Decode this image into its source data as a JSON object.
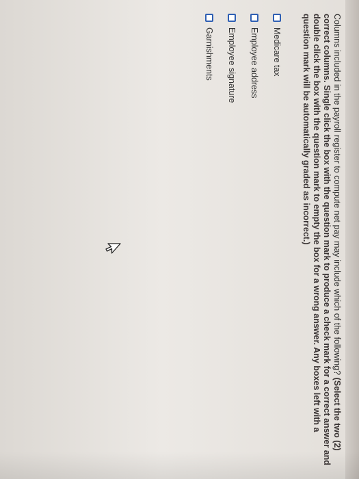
{
  "question": {
    "text": "Columns included in the payroll register to compute net pay may include which of the following?",
    "instructions": "(Select the two (2) correct columns. Single click the box with the question mark to produce a check mark for a correct answer and double click the box with the question mark to empty the box for a wrong answer. Any boxes left with a question mark will be automatically graded as incorrect.)"
  },
  "options": [
    {
      "label": "Medicare tax"
    },
    {
      "label": "Employee address"
    },
    {
      "label": "Employee signature"
    },
    {
      "label": "Garnishments"
    }
  ],
  "colors": {
    "checkbox_border": "#2f5fb3",
    "instructions_text": "#3a3434"
  },
  "icons": {
    "cursor": "mouse-pointer-icon"
  }
}
